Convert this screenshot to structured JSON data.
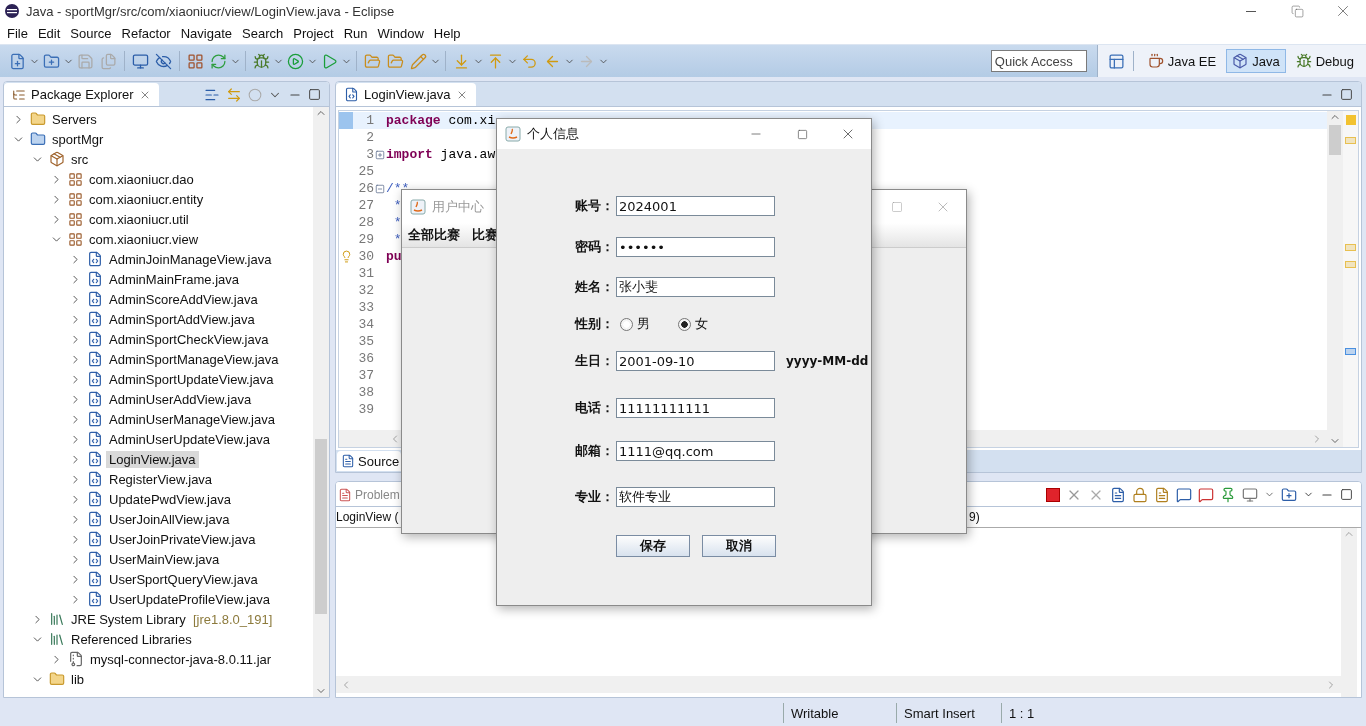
{
  "window": {
    "title": "Java - sportMgr/src/com/xiaoniucr/view/LoginView.java - Eclipse"
  },
  "menu": [
    "File",
    "Edit",
    "Source",
    "Refactor",
    "Navigate",
    "Search",
    "Project",
    "Run",
    "Window",
    "Help"
  ],
  "toolbar": {
    "quick_access": {
      "placeholder": "Quick Access"
    },
    "perspectives": [
      {
        "label": "Java EE",
        "selected": false
      },
      {
        "label": "Java",
        "selected": true
      },
      {
        "label": "Debug",
        "selected": false
      }
    ]
  },
  "package_explorer": {
    "title": "Package Explorer",
    "tree": [
      {
        "label": "Servers",
        "kind": "folder",
        "expanded": false,
        "selected": false
      },
      {
        "label": "sportMgr",
        "kind": "project",
        "expanded": true,
        "selected": false,
        "children": [
          {
            "label": "src",
            "kind": "source",
            "expanded": true,
            "selected": false,
            "children": [
              {
                "label": "com.xiaoniucr.dao",
                "kind": "package",
                "expanded": false,
                "selected": false
              },
              {
                "label": "com.xiaoniucr.entity",
                "kind": "package",
                "expanded": false,
                "selected": false
              },
              {
                "label": "com.xiaoniucr.util",
                "kind": "package",
                "expanded": false,
                "selected": false
              },
              {
                "label": "com.xiaoniucr.view",
                "kind": "package",
                "expanded": true,
                "selected": false,
                "children": [
                  {
                    "label": "AdminJoinManageView.java",
                    "kind": "file",
                    "expanded": false,
                    "selected": false
                  },
                  {
                    "label": "AdminMainFrame.java",
                    "kind": "file",
                    "expanded": false,
                    "selected": false
                  },
                  {
                    "label": "AdminScoreAddView.java",
                    "kind": "file",
                    "expanded": false,
                    "selected": false
                  },
                  {
                    "label": "AdminSportAddView.java",
                    "kind": "file",
                    "expanded": false,
                    "selected": false
                  },
                  {
                    "label": "AdminSportCheckView.java",
                    "kind": "file",
                    "expanded": false,
                    "selected": false
                  },
                  {
                    "label": "AdminSportManageView.java",
                    "kind": "file",
                    "expanded": false,
                    "selected": false
                  },
                  {
                    "label": "AdminSportUpdateView.java",
                    "kind": "file",
                    "expanded": false,
                    "selected": false
                  },
                  {
                    "label": "AdminUserAddView.java",
                    "kind": "file",
                    "expanded": false,
                    "selected": false
                  },
                  {
                    "label": "AdminUserManageView.java",
                    "kind": "file",
                    "expanded": false,
                    "selected": false
                  },
                  {
                    "label": "AdminUserUpdateView.java",
                    "kind": "file",
                    "expanded": false,
                    "selected": false
                  },
                  {
                    "label": "LoginView.java",
                    "kind": "file",
                    "expanded": false,
                    "selected": true
                  },
                  {
                    "label": "RegisterView.java",
                    "kind": "file",
                    "expanded": false,
                    "selected": false
                  },
                  {
                    "label": "UpdatePwdView.java",
                    "kind": "file",
                    "expanded": false,
                    "selected": false
                  },
                  {
                    "label": "UserJoinAllView.java",
                    "kind": "file",
                    "expanded": false,
                    "selected": false
                  },
                  {
                    "label": "UserJoinPrivateView.java",
                    "kind": "file",
                    "expanded": false,
                    "selected": false
                  },
                  {
                    "label": "UserMainView.java",
                    "kind": "file",
                    "expanded": false,
                    "selected": false
                  },
                  {
                    "label": "UserSportQueryView.java",
                    "kind": "file",
                    "expanded": false,
                    "selected": false
                  },
                  {
                    "label": "UserUpdateProfileView.java",
                    "kind": "file",
                    "expanded": false,
                    "selected": false
                  }
                ]
              }
            ]
          },
          {
            "label": "JRE System Library",
            "decoration": "[jre1.8.0_191]",
            "kind": "library",
            "expanded": false,
            "selected": false
          },
          {
            "label": "Referenced Libraries",
            "kind": "library",
            "expanded": true,
            "selected": false,
            "children": [
              {
                "label": "mysql-connector-java-8.0.11.jar",
                "kind": "jar",
                "expanded": false,
                "selected": false
              }
            ]
          },
          {
            "label": "lib",
            "kind": "folder",
            "expanded": true,
            "selected": false
          }
        ]
      }
    ]
  },
  "editor": {
    "tabs": [
      {
        "label": "LoginView.java",
        "selected": true
      }
    ],
    "lines": [
      {
        "number": "1",
        "keyword": "package",
        "text": " com.xi",
        "current": true,
        "warning": false
      },
      {
        "number": "2",
        "current": false,
        "warning": false
      },
      {
        "number": "3",
        "keyword": "import",
        "text": " java.aw",
        "folded": true,
        "current": false,
        "warning": false
      },
      {
        "number": "25",
        "current": false,
        "warning": false
      },
      {
        "number": "26",
        "comment": "/**",
        "folded": false,
        "current": false,
        "warning": false
      },
      {
        "number": "27",
        "comment": " *",
        "current": false,
        "warning": false
      },
      {
        "number": "28",
        "comment": " *",
        "current": false,
        "warning": false
      },
      {
        "number": "29",
        "comment": " *",
        "current": false,
        "warning": false
      },
      {
        "number": "30",
        "keyword": "pu",
        "current": false,
        "warning": true
      },
      {
        "number": "31",
        "current": false,
        "warning": false
      },
      {
        "number": "32",
        "current": false,
        "warning": false
      },
      {
        "number": "33",
        "current": false,
        "warning": false
      },
      {
        "number": "34",
        "current": false,
        "warning": false
      },
      {
        "number": "35",
        "current": false,
        "warning": false
      },
      {
        "number": "36",
        "current": false,
        "warning": false
      },
      {
        "number": "37",
        "current": false,
        "warning": false
      },
      {
        "number": "38",
        "current": false,
        "warning": false
      },
      {
        "number": "39",
        "current": false,
        "warning": false
      }
    ],
    "bottom_tabs": [
      {
        "label": "Source",
        "selected": true
      }
    ]
  },
  "problems": {
    "tab": "Problem",
    "row_start": "LoginView (",
    "row_end": "9)"
  },
  "status_bar": [
    "Writable",
    "Smart Insert",
    "1 : 1"
  ],
  "user_center": {
    "title": "用户中心",
    "menus": [
      "全部比赛",
      "比赛"
    ]
  },
  "profile_dialog": {
    "title": "个人信息",
    "fields": [
      {
        "kind": "text",
        "label": "账号：",
        "value": "2024001"
      },
      {
        "kind": "text",
        "label": "密码：",
        "value": "••••••"
      },
      {
        "kind": "text",
        "label": "姓名：",
        "value": "张小斐"
      },
      {
        "kind": "radio",
        "label": "性别：",
        "options": [
          {
            "label": "男",
            "selected": false
          },
          {
            "label": "女",
            "selected": true
          }
        ]
      },
      {
        "kind": "text",
        "label": "生日：",
        "value": "2001-09-10",
        "hint": "yyyy-MM-dd"
      },
      {
        "kind": "text",
        "label": "电话：",
        "value": "11111111111"
      },
      {
        "kind": "text",
        "label": "邮箱：",
        "value": "1111@qq.com"
      },
      {
        "kind": "text",
        "label": "专业：",
        "value": "软件专业"
      }
    ],
    "buttons": [
      "保存",
      "取消"
    ]
  }
}
